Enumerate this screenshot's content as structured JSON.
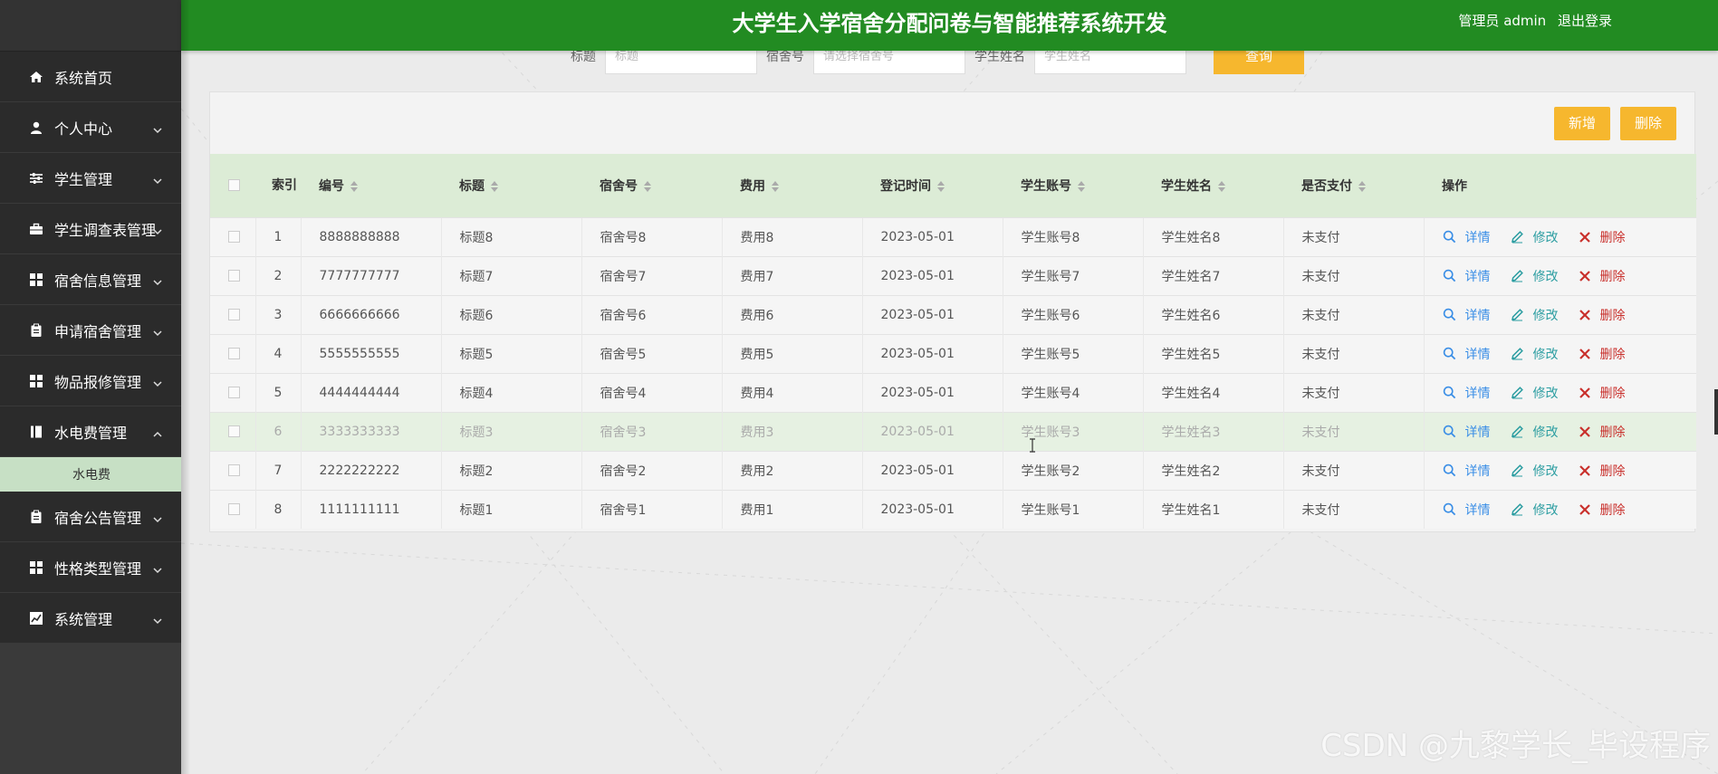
{
  "header": {
    "title": "大学生入学宿舍分配问卷与智能推荐系统开发",
    "user_label": "管理员 admin",
    "logout_label": "退出登录"
  },
  "sidebar": {
    "items": [
      {
        "label": "系统首页",
        "icon": "home-icon",
        "expandable": false
      },
      {
        "label": "个人中心",
        "icon": "user-icon",
        "expandable": true
      },
      {
        "label": "学生管理",
        "icon": "sliders-icon",
        "expandable": true
      },
      {
        "label": "学生调查表管理",
        "icon": "briefcase-icon",
        "expandable": true
      },
      {
        "label": "宿舍信息管理",
        "icon": "grid-icon",
        "expandable": true
      },
      {
        "label": "申请宿舍管理",
        "icon": "clipboard-icon",
        "expandable": true
      },
      {
        "label": "物品报修管理",
        "icon": "grid-icon",
        "expandable": true
      },
      {
        "label": "水电费管理",
        "icon": "book-icon",
        "expandable": true,
        "expanded": true
      },
      {
        "label": "宿舍公告管理",
        "icon": "clipboard-icon",
        "expandable": true
      },
      {
        "label": "性格类型管理",
        "icon": "grid-icon",
        "expandable": true
      },
      {
        "label": "系统管理",
        "icon": "chart-icon",
        "expandable": true
      }
    ],
    "submenu": {
      "label": "水电费"
    }
  },
  "search": {
    "fields": [
      {
        "label": "标题",
        "placeholder": "标题"
      },
      {
        "label": "宿舍号",
        "placeholder": "请选择宿舍号"
      },
      {
        "label": "学生姓名",
        "placeholder": "学生姓名"
      }
    ],
    "button_label": "查询"
  },
  "actions": {
    "add_label": "新增",
    "delete_label": "删除"
  },
  "table": {
    "columns": [
      "索引",
      "编号",
      "标题",
      "宿舍号",
      "费用",
      "登记时间",
      "学生账号",
      "学生姓名",
      "是否支付",
      "操作"
    ],
    "ops": {
      "detail": "详情",
      "edit": "修改",
      "delete": "删除"
    },
    "rows": [
      {
        "index": "1",
        "code": "8888888888",
        "title": "标题8",
        "dorm": "宿舍号8",
        "fee": "费用8",
        "time": "2023-05-01",
        "account": "学生账号8",
        "name": "学生姓名8",
        "paid": "未支付"
      },
      {
        "index": "2",
        "code": "7777777777",
        "title": "标题7",
        "dorm": "宿舍号7",
        "fee": "费用7",
        "time": "2023-05-01",
        "account": "学生账号7",
        "name": "学生姓名7",
        "paid": "未支付"
      },
      {
        "index": "3",
        "code": "6666666666",
        "title": "标题6",
        "dorm": "宿舍号6",
        "fee": "费用6",
        "time": "2023-05-01",
        "account": "学生账号6",
        "name": "学生姓名6",
        "paid": "未支付"
      },
      {
        "index": "4",
        "code": "5555555555",
        "title": "标题5",
        "dorm": "宿舍号5",
        "fee": "费用5",
        "time": "2023-05-01",
        "account": "学生账号5",
        "name": "学生姓名5",
        "paid": "未支付"
      },
      {
        "index": "5",
        "code": "4444444444",
        "title": "标题4",
        "dorm": "宿舍号4",
        "fee": "费用4",
        "time": "2023-05-01",
        "account": "学生账号4",
        "name": "学生姓名4",
        "paid": "未支付"
      },
      {
        "index": "6",
        "code": "3333333333",
        "title": "标题3",
        "dorm": "宿舍号3",
        "fee": "费用3",
        "time": "2023-05-01",
        "account": "学生账号3",
        "name": "学生姓名3",
        "paid": "未支付"
      },
      {
        "index": "7",
        "code": "2222222222",
        "title": "标题2",
        "dorm": "宿舍号2",
        "fee": "费用2",
        "time": "2023-05-01",
        "account": "学生账号2",
        "name": "学生姓名2",
        "paid": "未支付"
      },
      {
        "index": "8",
        "code": "1111111111",
        "title": "标题1",
        "dorm": "宿舍号1",
        "fee": "费用1",
        "time": "2023-05-01",
        "account": "学生账号1",
        "name": "学生姓名1",
        "paid": "未支付"
      }
    ]
  },
  "watermark": "CSDN @九黎学长_毕设程序",
  "colors": {
    "header": "#228b22",
    "sidebar": "#2b2b2b",
    "accent": "#f6b72e",
    "submenu": "#c7e0c5",
    "table_header": "#dcecd6"
  }
}
